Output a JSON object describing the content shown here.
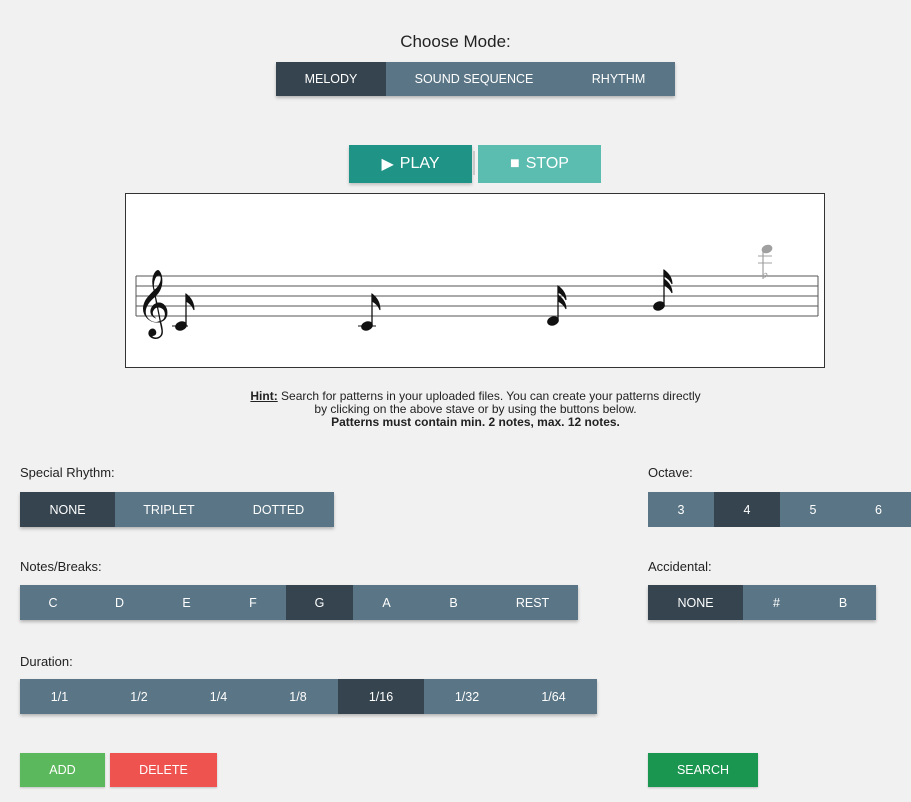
{
  "mode": {
    "title": "Choose Mode:",
    "options": [
      "MELODY",
      "SOUND SEQUENCE",
      "RHYTHM"
    ],
    "selected": "MELODY"
  },
  "player": {
    "play_label": "PLAY",
    "stop_label": "STOP"
  },
  "hint": {
    "prefix": "Hint:",
    "line1": " Search for patterns in your uploaded files. You can create your patterns directly",
    "line2": "by clicking on the above stave or by using the buttons below.",
    "line3": "Patterns must contain min. 2 notes, max. 12 notes."
  },
  "special_rhythm": {
    "label": "Special Rhythm:",
    "options": [
      "NONE",
      "TRIPLET",
      "DOTTED"
    ],
    "selected": "NONE"
  },
  "octave": {
    "label": "Octave:",
    "options": [
      "3",
      "4",
      "5",
      "6"
    ],
    "selected": "4"
  },
  "notes": {
    "label": "Notes/Breaks:",
    "options": [
      "C",
      "D",
      "E",
      "F",
      "G",
      "A",
      "B",
      "REST"
    ],
    "selected": "G"
  },
  "accidental": {
    "label": "Accidental:",
    "options": [
      "NONE",
      "#",
      "B"
    ],
    "selected": "NONE"
  },
  "duration": {
    "label": "Duration:",
    "options": [
      "1/1",
      "1/2",
      "1/4",
      "1/8",
      "1/16",
      "1/32",
      "1/64"
    ],
    "selected": "1/16"
  },
  "actions": {
    "add_label": "ADD",
    "delete_label": "DELETE",
    "search_label": "SEARCH"
  },
  "stave": {
    "clef": "treble",
    "notes": [
      {
        "pitch": "C4",
        "duration": "1/8"
      },
      {
        "pitch": "C4",
        "duration": "1/8"
      },
      {
        "pitch": "E4",
        "duration": "1/16"
      },
      {
        "pitch": "G4",
        "duration": "1/16"
      },
      {
        "pitch": "C5",
        "duration": "1/16",
        "preview": true,
        "accidental": "b"
      }
    ]
  },
  "colors": {
    "segment": "#5a7585",
    "segment_active": "#35444f",
    "play": "#1f9486",
    "stop": "#5bbcb0",
    "add": "#5cb85c",
    "delete": "#ef5350",
    "search": "#1a9650"
  }
}
